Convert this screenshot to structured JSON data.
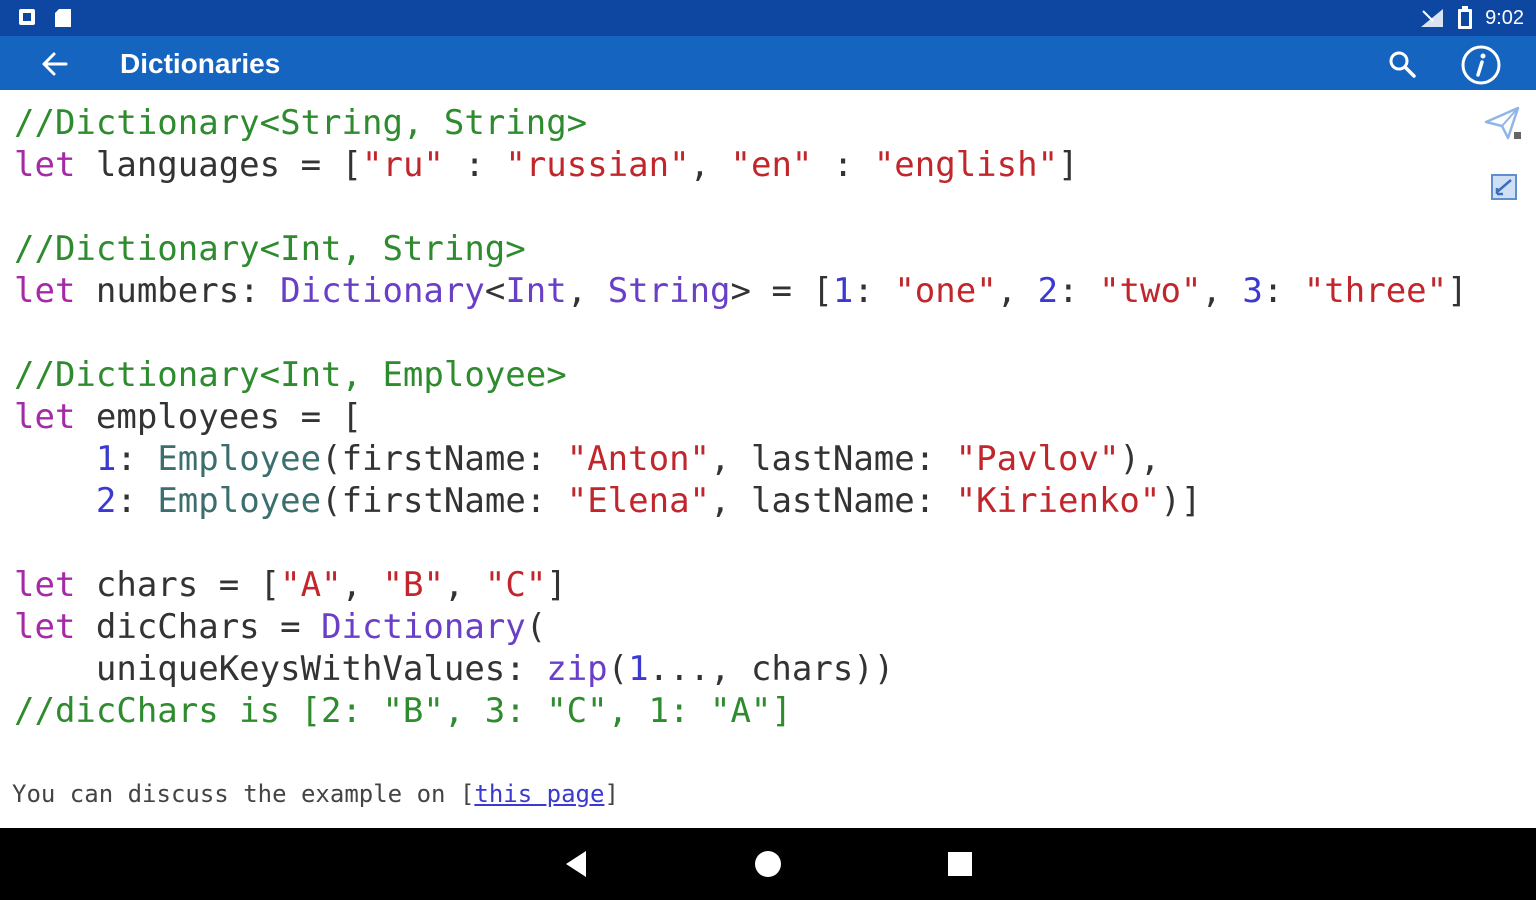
{
  "status_bar": {
    "time": "9:02",
    "left_icons": [
      "notification-icon",
      "sd-card-icon"
    ],
    "right_icons": [
      "signal-icon",
      "battery-icon"
    ]
  },
  "app_bar": {
    "title": "Dictionaries",
    "back_icon": "arrow-left-icon",
    "search_icon": "search-icon",
    "info_icon": "info-icon"
  },
  "code": {
    "lines": [
      [
        {
          "t": "//Dictionary<String, String>",
          "c": "comment"
        }
      ],
      [
        {
          "t": "let",
          "c": "keyword"
        },
        {
          "t": " languages = [",
          "c": "plain"
        },
        {
          "t": "\"ru\"",
          "c": "string"
        },
        {
          "t": " : ",
          "c": "plain"
        },
        {
          "t": "\"russian\"",
          "c": "string"
        },
        {
          "t": ", ",
          "c": "plain"
        },
        {
          "t": "\"en\"",
          "c": "string"
        },
        {
          "t": " : ",
          "c": "plain"
        },
        {
          "t": "\"english\"",
          "c": "string"
        },
        {
          "t": "]",
          "c": "plain"
        }
      ],
      [],
      [
        {
          "t": "//Dictionary<Int, String>",
          "c": "comment"
        }
      ],
      [
        {
          "t": "let",
          "c": "keyword"
        },
        {
          "t": " numbers: ",
          "c": "plain"
        },
        {
          "t": "Dictionary",
          "c": "type"
        },
        {
          "t": "<",
          "c": "plain"
        },
        {
          "t": "Int",
          "c": "type"
        },
        {
          "t": ", ",
          "c": "plain"
        },
        {
          "t": "String",
          "c": "type"
        },
        {
          "t": "> = [",
          "c": "plain"
        },
        {
          "t": "1",
          "c": "number"
        },
        {
          "t": ": ",
          "c": "plain"
        },
        {
          "t": "\"one\"",
          "c": "string"
        },
        {
          "t": ", ",
          "c": "plain"
        },
        {
          "t": "2",
          "c": "number"
        },
        {
          "t": ": ",
          "c": "plain"
        },
        {
          "t": "\"two\"",
          "c": "string"
        },
        {
          "t": ", ",
          "c": "plain"
        },
        {
          "t": "3",
          "c": "number"
        },
        {
          "t": ": ",
          "c": "plain"
        },
        {
          "t": "\"three\"",
          "c": "string"
        },
        {
          "t": "]",
          "c": "plain"
        }
      ],
      [],
      [
        {
          "t": "//Dictionary<Int, Employee>",
          "c": "comment"
        }
      ],
      [
        {
          "t": "let",
          "c": "keyword"
        },
        {
          "t": " employees = [",
          "c": "plain"
        }
      ],
      [
        {
          "t": "    ",
          "c": "plain"
        },
        {
          "t": "1",
          "c": "number"
        },
        {
          "t": ": ",
          "c": "plain"
        },
        {
          "t": "Employee",
          "c": "cls"
        },
        {
          "t": "(firstName: ",
          "c": "plain"
        },
        {
          "t": "\"Anton\"",
          "c": "string"
        },
        {
          "t": ", lastName: ",
          "c": "plain"
        },
        {
          "t": "\"Pavlov\"",
          "c": "string"
        },
        {
          "t": "),",
          "c": "plain"
        }
      ],
      [
        {
          "t": "    ",
          "c": "plain"
        },
        {
          "t": "2",
          "c": "number"
        },
        {
          "t": ": ",
          "c": "plain"
        },
        {
          "t": "Employee",
          "c": "cls"
        },
        {
          "t": "(firstName: ",
          "c": "plain"
        },
        {
          "t": "\"Elena\"",
          "c": "string"
        },
        {
          "t": ", lastName: ",
          "c": "plain"
        },
        {
          "t": "\"Kirienko\"",
          "c": "string"
        },
        {
          "t": ")]",
          "c": "plain"
        }
      ],
      [],
      [
        {
          "t": "let",
          "c": "keyword"
        },
        {
          "t": " chars = [",
          "c": "plain"
        },
        {
          "t": "\"A\"",
          "c": "string"
        },
        {
          "t": ", ",
          "c": "plain"
        },
        {
          "t": "\"B\"",
          "c": "string"
        },
        {
          "t": ", ",
          "c": "plain"
        },
        {
          "t": "\"C\"",
          "c": "string"
        },
        {
          "t": "]",
          "c": "plain"
        }
      ],
      [
        {
          "t": "let",
          "c": "keyword"
        },
        {
          "t": " dicChars = ",
          "c": "plain"
        },
        {
          "t": "Dictionary",
          "c": "type"
        },
        {
          "t": "(",
          "c": "plain"
        }
      ],
      [
        {
          "t": "    uniqueKeysWithValues: ",
          "c": "plain"
        },
        {
          "t": "zip",
          "c": "type"
        },
        {
          "t": "(",
          "c": "plain"
        },
        {
          "t": "1",
          "c": "number"
        },
        {
          "t": "..., chars))",
          "c": "plain"
        }
      ],
      [
        {
          "t": "//dicChars is [2: \"B\", 3: \"C\", 1: \"A\"]",
          "c": "comment"
        }
      ]
    ]
  },
  "side_tools": {
    "share_icon": "send-icon",
    "edit_icon": "edit-checkbox-icon"
  },
  "footer": {
    "prefix": "You can discuss the example on ",
    "bracket_open": "[",
    "link_text": "this page",
    "bracket_close": "]"
  },
  "nav_bar": {
    "back_icon": "nav-back-icon",
    "home_icon": "nav-home-icon",
    "recents_icon": "nav-recents-icon"
  },
  "colors": {
    "status_bar": "#0d47a1",
    "app_bar": "#1565c0",
    "comment": "#2e8b2e",
    "keyword": "#a52aa5",
    "string": "#c0262b",
    "type": "#6a3fc8",
    "number": "#3a3ad0"
  }
}
